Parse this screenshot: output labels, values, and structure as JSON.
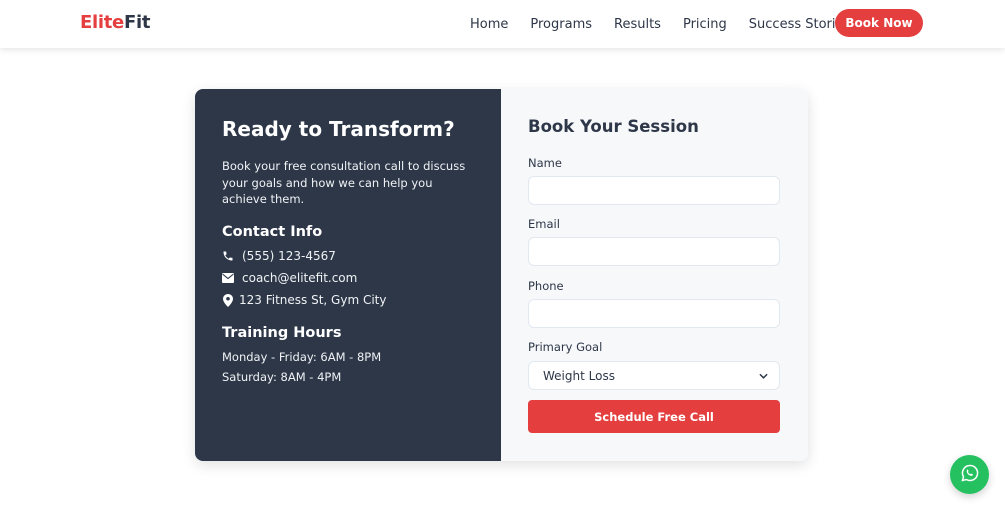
{
  "header": {
    "logo_part1": "Elite",
    "logo_part2": "Fit",
    "nav": [
      "Home",
      "Programs",
      "Results",
      "Pricing",
      "Success Stories"
    ],
    "book_now": "Book Now"
  },
  "info": {
    "title": "Ready to Transform?",
    "description": "Book your free consultation call to discuss your goals and how we can help you achieve them.",
    "contact_title": "Contact Info",
    "phone": "(555) 123-4567",
    "email": "coach@elitefit.com",
    "address": "123 Fitness St, Gym City",
    "hours_title": "Training Hours",
    "hours": [
      "Monday - Friday: 6AM - 8PM",
      "Saturday: 8AM - 4PM"
    ]
  },
  "form": {
    "title": "Book Your Session",
    "name_label": "Name",
    "name_value": "",
    "email_label": "Email",
    "email_value": "",
    "phone_label": "Phone",
    "phone_value": "",
    "goal_label": "Primary Goal",
    "goal_selected": "Weight Loss",
    "submit": "Schedule Free Call"
  },
  "colors": {
    "brand_red": "#e53e3e",
    "panel_dark": "#2d3748",
    "whatsapp_green": "#25c160"
  },
  "icons": [
    "phone-icon",
    "envelope-icon",
    "map-pin-icon",
    "chevron-down-icon",
    "whatsapp-icon"
  ]
}
